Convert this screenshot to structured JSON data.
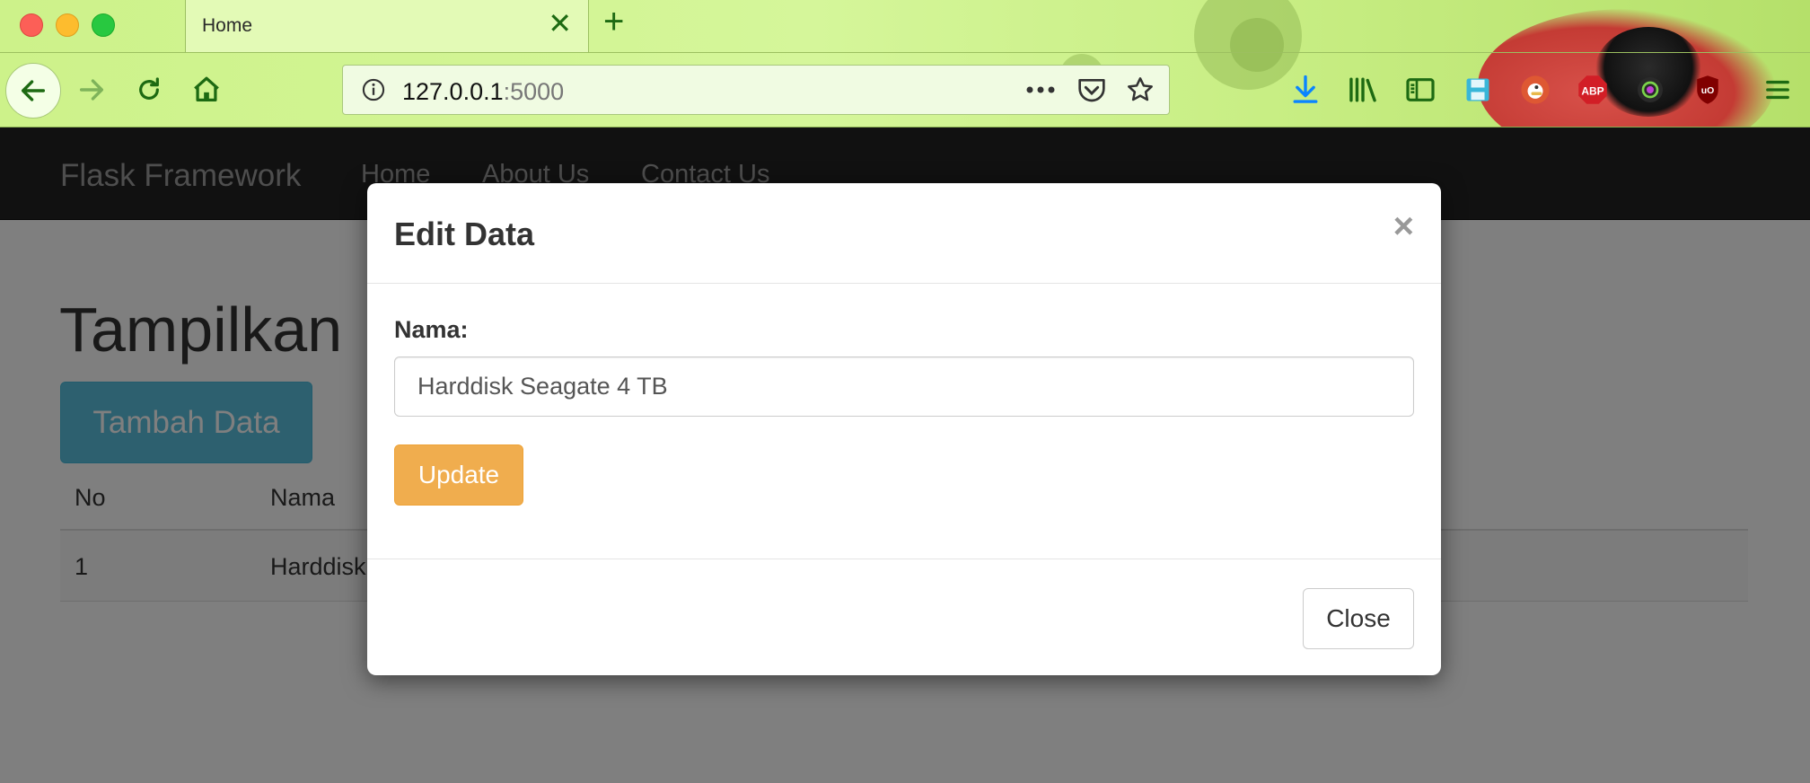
{
  "browser": {
    "tab_title": "Home",
    "url_host": "127.0.0.1",
    "url_port": ":5000",
    "icons": [
      "back-icon",
      "forward-icon",
      "reload-icon",
      "home-icon",
      "info-icon",
      "more-icon",
      "pocket-icon",
      "bookmark-star-icon",
      "download-icon",
      "library-icon",
      "sidebar-icon",
      "save-icon",
      "duckduckgo-icon",
      "adblock-plus-icon",
      "extension-icon",
      "ublock-icon",
      "menu-icon"
    ],
    "adblock_label": "ABP",
    "ublock_label": "uO"
  },
  "navbar": {
    "brand": "Flask Framework",
    "links": [
      "Home",
      "About Us",
      "Contact Us"
    ]
  },
  "page": {
    "heading": "Tampilkan",
    "add_button": "Tambah Data",
    "table": {
      "headers": [
        "No",
        "Nama"
      ],
      "rows": [
        [
          "1",
          "Harddisk"
        ]
      ]
    }
  },
  "modal": {
    "title": "Edit Data",
    "close_symbol": "×",
    "field_label": "Nama:",
    "field_value": "Harddisk Seagate 4 TB",
    "update_button": "Update",
    "close_button": "Close"
  },
  "colors": {
    "navbar_bg": "#222222",
    "btn_info": "#5bc0de",
    "btn_warning": "#f0ad4e"
  }
}
